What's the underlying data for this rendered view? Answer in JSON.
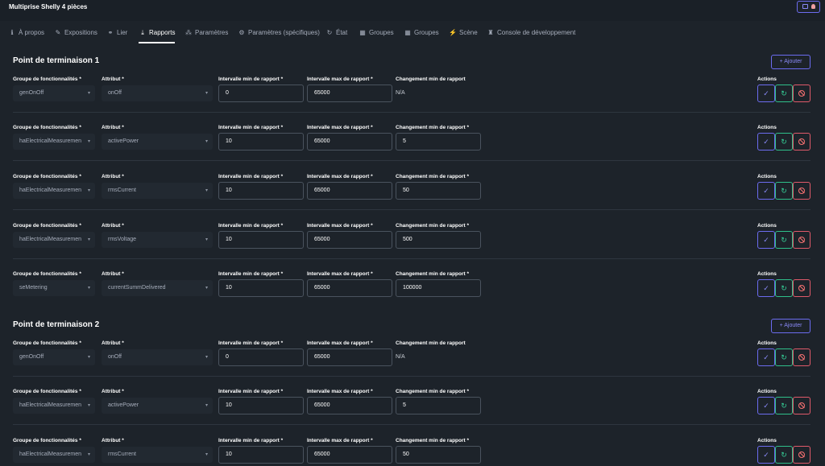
{
  "app": {
    "title": "Multiprise Shelly 4 pièces"
  },
  "tabs": [
    {
      "label": "À propos",
      "icon": "info-icon"
    },
    {
      "label": "Expositions",
      "icon": "pencil-icon"
    },
    {
      "label": "Lier",
      "icon": "link-icon"
    },
    {
      "label": "Rapports",
      "icon": "download-icon",
      "active": true
    },
    {
      "label": "Paramètres",
      "icon": "nodes-icon"
    },
    {
      "label": "Paramètres (spécifiques)",
      "icon": "gear-icon"
    },
    {
      "label": "État",
      "icon": "refresh-icon"
    },
    {
      "label": "Groupes",
      "icon": "grid-icon"
    },
    {
      "label": "Groupes",
      "icon": "grid-icon"
    },
    {
      "label": "Scène",
      "icon": "wand-icon"
    },
    {
      "label": "Console de développement",
      "icon": "robot-icon"
    }
  ],
  "labels": {
    "cluster": "Groupe de fonctionnalités *",
    "attribute": "Attribut *",
    "min_interval": "Intervalle min de rapport *",
    "max_interval": "Intervalle max de rapport *",
    "min_change": "Changement min de rapport",
    "min_change_req": "Changement min de rapport *",
    "actions": "Actions",
    "add": "Ajouter"
  },
  "endpoints": [
    {
      "title": "Point de terminaison 1",
      "rows": [
        {
          "cluster": "genOnOff",
          "attribute": "onOff",
          "min": "0",
          "max": "65000",
          "change": "N/A"
        },
        {
          "cluster": "haElectricalMeasuremen",
          "attribute": "activePower",
          "min": "10",
          "max": "65000",
          "change": "5"
        },
        {
          "cluster": "haElectricalMeasuremen",
          "attribute": "rmsCurrent",
          "min": "10",
          "max": "65000",
          "change": "50"
        },
        {
          "cluster": "haElectricalMeasuremen",
          "attribute": "rmsVoltage",
          "min": "10",
          "max": "65000",
          "change": "500"
        },
        {
          "cluster": "seMetering",
          "attribute": "currentSummDelivered",
          "min": "10",
          "max": "65000",
          "change": "100000"
        }
      ]
    },
    {
      "title": "Point de terminaison 2",
      "rows": [
        {
          "cluster": "genOnOff",
          "attribute": "onOff",
          "min": "0",
          "max": "65000",
          "change": "N/A"
        },
        {
          "cluster": "haElectricalMeasuremen",
          "attribute": "activePower",
          "min": "10",
          "max": "65000",
          "change": "5"
        },
        {
          "cluster": "haElectricalMeasuremen",
          "attribute": "rmsCurrent",
          "min": "10",
          "max": "65000",
          "change": "50"
        }
      ]
    }
  ]
}
